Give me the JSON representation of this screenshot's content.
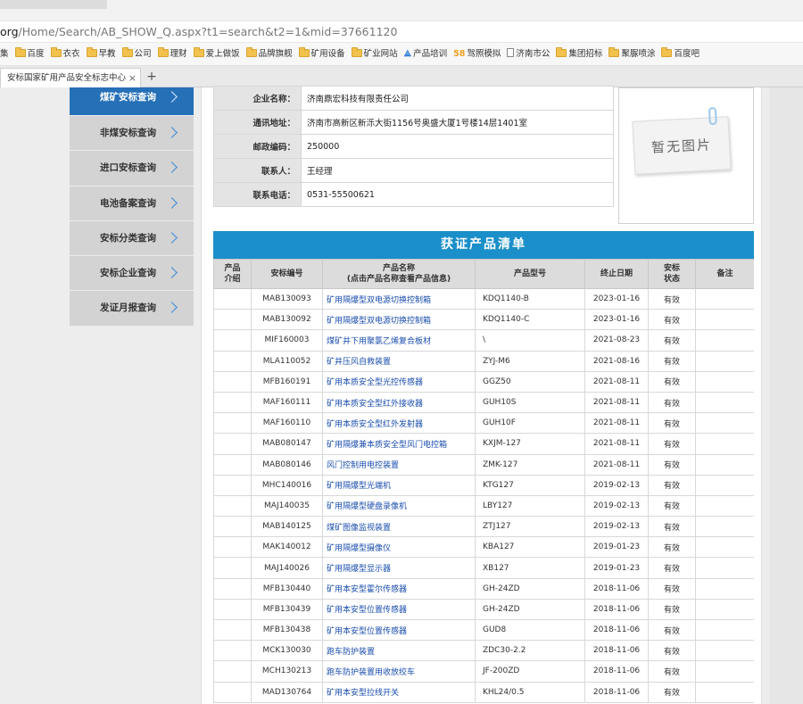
{
  "browser": {
    "address": {
      "host": "org",
      "path": "/Home/Search/AB_SHOW_Q.aspx?t1=search&t2=1&mid=37661120"
    },
    "bookmarks": [
      {
        "label": "集",
        "icon": "none"
      },
      {
        "label": "百度",
        "icon": "folder-icon"
      },
      {
        "label": "衣衣",
        "icon": "folder-icon"
      },
      {
        "label": "早教",
        "icon": "folder-icon"
      },
      {
        "label": "公司",
        "icon": "folder-icon"
      },
      {
        "label": "理财",
        "icon": "folder-icon"
      },
      {
        "label": "爱上做饭",
        "icon": "folder-icon"
      },
      {
        "label": "品牌旗舰",
        "icon": "folder-icon"
      },
      {
        "label": "矿用设备",
        "icon": "folder-icon"
      },
      {
        "label": "矿业网站",
        "icon": "folder-icon"
      },
      {
        "label": "产品培训",
        "icon": "brand-icon"
      },
      {
        "label": "驾照模拟",
        "icon": "58-icon"
      },
      {
        "label": "济南市公",
        "icon": "page-icon"
      },
      {
        "label": "集团招标",
        "icon": "folder-icon"
      },
      {
        "label": "聚脲喷涂",
        "icon": "folder-icon"
      },
      {
        "label": "百度吧",
        "icon": "folder-icon"
      }
    ],
    "tab": {
      "title": "安标国家矿用产品安全标志中心",
      "close": "×"
    },
    "new_tab": "+"
  },
  "sidebar": {
    "items": [
      {
        "label": "煤矿安标查询",
        "active": true
      },
      {
        "label": "非煤安标查询",
        "active": false
      },
      {
        "label": "进口安标查询",
        "active": false
      },
      {
        "label": "电池备案查询",
        "active": false
      },
      {
        "label": "安标分类查询",
        "active": false
      },
      {
        "label": "安标企业查询",
        "active": false
      },
      {
        "label": "发证月报查询",
        "active": false
      }
    ]
  },
  "company": {
    "rows": [
      {
        "label": "企业名称：",
        "value": "济南鼎宏科技有限责任公司"
      },
      {
        "label": "通讯地址：",
        "value": "济南市高新区新泺大街1156号奥盛大厦1号楼14层1401室"
      },
      {
        "label": "邮政编码：",
        "value": "250000"
      },
      {
        "label": "联系人：",
        "value": "王经理"
      },
      {
        "label": "联系电话：",
        "value": "0531-55500621"
      }
    ],
    "no_image_text": "暂无图片"
  },
  "products": {
    "title": "获证产品清单",
    "headers": {
      "intro": "产品\n介绍",
      "code": "安标编号",
      "name": "产品名称\n(点击产品名称查看产品信息)",
      "model": "产品型号",
      "expiry": "终止日期",
      "status": "安标\n状态",
      "remark": "备注"
    },
    "rows": [
      {
        "code": "MAB130093",
        "name": "矿用隔爆型双电源切换控制箱",
        "model": "KDQ1140-B",
        "expiry": "2023-01-16",
        "status": "有效"
      },
      {
        "code": "MAB130092",
        "name": "矿用隔爆型双电源切换控制箱",
        "model": "KDQ1140-C",
        "expiry": "2023-01-16",
        "status": "有效"
      },
      {
        "code": "MIF160003",
        "name": "煤矿井下用聚氯乙烯复合板材",
        "model": "\\",
        "expiry": "2021-08-23",
        "status": "有效"
      },
      {
        "code": "MLA110052",
        "name": "矿井压风自救装置",
        "model": "ZYJ-M6",
        "expiry": "2021-08-16",
        "status": "有效"
      },
      {
        "code": "MFB160191",
        "name": "矿用本质安全型光控传感器",
        "model": "GGZ50",
        "expiry": "2021-08-11",
        "status": "有效"
      },
      {
        "code": "MAF160111",
        "name": "矿用本质安全型红外接收器",
        "model": "GUH10S",
        "expiry": "2021-08-11",
        "status": "有效"
      },
      {
        "code": "MAF160110",
        "name": "矿用本质安全型红外发射器",
        "model": "GUH10F",
        "expiry": "2021-08-11",
        "status": "有效"
      },
      {
        "code": "MAB080147",
        "name": "矿用隔爆兼本质安全型风门电控箱",
        "model": "KXJM-127",
        "expiry": "2021-08-11",
        "status": "有效"
      },
      {
        "code": "MAB080146",
        "name": "风门控制用电控装置",
        "model": "ZMK-127",
        "expiry": "2021-08-11",
        "status": "有效"
      },
      {
        "code": "MHC140016",
        "name": "矿用隔爆型光端机",
        "model": "KTG127",
        "expiry": "2019-02-13",
        "status": "有效"
      },
      {
        "code": "MAJ140035",
        "name": "矿用隔爆型硬盘录像机",
        "model": "LBY127",
        "expiry": "2019-02-13",
        "status": "有效"
      },
      {
        "code": "MAB140125",
        "name": "煤矿图像监视装置",
        "model": "ZTJ127",
        "expiry": "2019-02-13",
        "status": "有效"
      },
      {
        "code": "MAK140012",
        "name": "矿用隔爆型摄像仪",
        "model": "KBA127",
        "expiry": "2019-01-23",
        "status": "有效"
      },
      {
        "code": "MAJ140026",
        "name": "矿用隔爆型显示器",
        "model": "XB127",
        "expiry": "2019-01-23",
        "status": "有效"
      },
      {
        "code": "MFB130440",
        "name": "矿用本安型霍尔传感器",
        "model": "GH-24ZD",
        "expiry": "2018-11-06",
        "status": "有效"
      },
      {
        "code": "MFB130439",
        "name": "矿用本安型位置传感器",
        "model": "GH-24ZD",
        "expiry": "2018-11-06",
        "status": "有效"
      },
      {
        "code": "MFB130438",
        "name": "矿用本安型位置传感器",
        "model": "GUD8",
        "expiry": "2018-11-06",
        "status": "有效"
      },
      {
        "code": "MCK130030",
        "name": "跑车防护装置",
        "model": "ZDC30-2.2",
        "expiry": "2018-11-06",
        "status": "有效"
      },
      {
        "code": "MCH130213",
        "name": "跑车防护装置用收放绞车",
        "model": "JF-200ZD",
        "expiry": "2018-11-06",
        "status": "有效"
      },
      {
        "code": "MAD130764",
        "name": "矿用本安型拉线开关",
        "model": "KHL24/0.5",
        "expiry": "2018-11-06",
        "status": "有效"
      }
    ]
  }
}
